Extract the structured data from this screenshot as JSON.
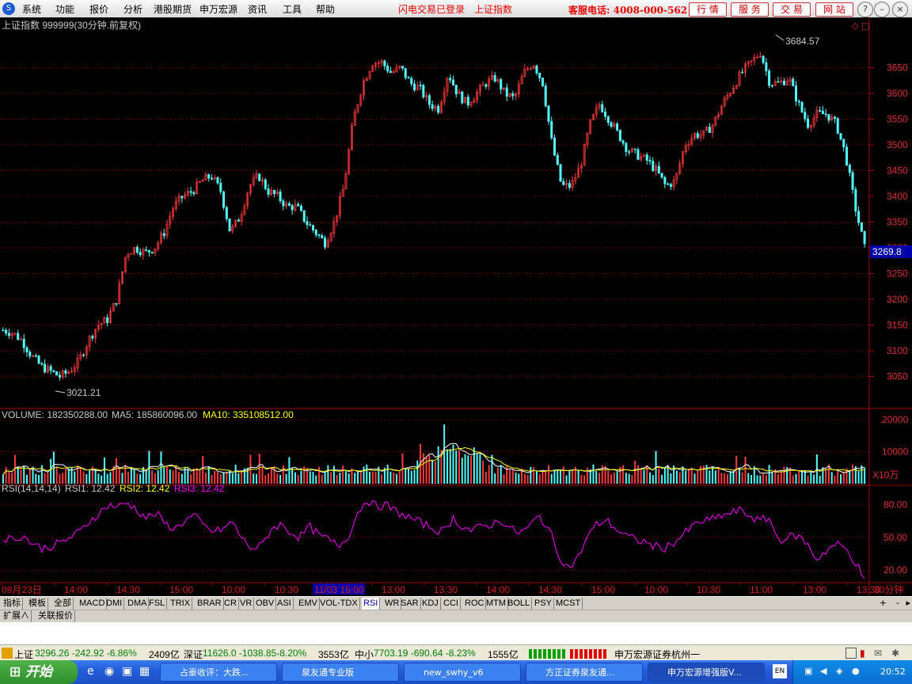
{
  "menubar": {
    "items": [
      "系统",
      "功能",
      "报价",
      "分析",
      "港股期货",
      "申万宏源",
      "资讯",
      "工具",
      "帮助"
    ],
    "notice1": "闪电交易已登录",
    "notice2": "上证指数",
    "hotline": "客服电话: 4008-000-562",
    "buttons": [
      "行 情",
      "服 务",
      "交 易",
      "网 站"
    ]
  },
  "chart": {
    "title": "上证指数 999999(30分钟.前复权)",
    "price_label": "3269.8",
    "high_label": "3684.57",
    "low_label": "3021.21",
    "volume_header": {
      "volume": "VOLUME: 182350288.00",
      "ma5": "MA5: 185860096.00",
      "ma10": "MA10: 335108512.00"
    },
    "volume_unit": "X10万",
    "rsi_header": {
      "name": "RSI(14,14,14)",
      "rsi1": "RSI1: 12.42",
      "rsi2": "RSI2: 12.42",
      "rsi3": "RSI3: 12.42"
    },
    "period_label": "30分钟",
    "time_labels": [
      "09月23日",
      "14:00",
      "14:30",
      "15:00",
      "10:00",
      "10:30",
      "11/03 15:00",
      "13:00",
      "13:30",
      "14:00",
      "14:30",
      "15:00",
      "10:00",
      "10:30",
      "11:00",
      "13:00",
      "13:30"
    ],
    "colors": {
      "up": "#ff3b3b",
      "down": "#54ffff",
      "ma5": "#ffffff",
      "ma10": "#ffff00",
      "rsi": "#ff00ff",
      "grid": "#7a0000"
    }
  },
  "chart_data": [
    {
      "type": "candlestick",
      "title": "上证指数 999999(30分钟.前复权)",
      "ylim": [
        3000,
        3720
      ],
      "yticks": [
        3050,
        3100,
        3150,
        3200,
        3250,
        3300,
        3350,
        3400,
        3450,
        3500,
        3550,
        3600,
        3650
      ],
      "annotations": {
        "high": 3684.57,
        "low": 3021.21,
        "last": 3269.8
      },
      "close_approx": [
        3140,
        3135,
        3120,
        3090,
        3070,
        3060,
        3050,
        3060,
        3080,
        3120,
        3150,
        3160,
        3200,
        3290,
        3300,
        3290,
        3300,
        3330,
        3380,
        3400,
        3410,
        3430,
        3440,
        3410,
        3330,
        3360,
        3420,
        3440,
        3410,
        3400,
        3380,
        3380,
        3350,
        3330,
        3310,
        3350,
        3420,
        3550,
        3620,
        3660,
        3660,
        3640,
        3650,
        3620,
        3610,
        3580,
        3570,
        3640,
        3600,
        3580,
        3600,
        3620,
        3630,
        3600,
        3590,
        3640,
        3660,
        3620,
        3500,
        3420,
        3420,
        3460,
        3540,
        3580,
        3550,
        3520,
        3490,
        3480,
        3470,
        3450,
        3420,
        3430,
        3500,
        3520,
        3520,
        3540,
        3580,
        3610,
        3640,
        3660,
        3680,
        3620,
        3620,
        3630,
        3580,
        3540,
        3560,
        3560,
        3540,
        3480,
        3380,
        3300
      ],
      "xlabels": [
        "09月23日",
        "14:00",
        "14:30",
        "15:00",
        "10:00",
        "10:30",
        "11/03 15:00",
        "13:00",
        "13:30",
        "14:00",
        "14:30",
        "15:00",
        "10:00",
        "10:30",
        "11:00",
        "13:00",
        "13:30"
      ]
    },
    {
      "type": "bar",
      "title": "VOLUME",
      "unit": "X10万",
      "ylim": [
        0,
        22000
      ],
      "yticks": [
        10000,
        20000
      ],
      "value_range_approx": [
        1500,
        19000
      ]
    },
    {
      "type": "line",
      "title": "RSI(14,14,14)",
      "ylim": [
        10,
        95
      ],
      "yticks": [
        20,
        50,
        80
      ],
      "values_approx": [
        50,
        48,
        52,
        45,
        40,
        42,
        45,
        50,
        55,
        65,
        72,
        80,
        78,
        82,
        75,
        68,
        72,
        62,
        58,
        66,
        70,
        60,
        55,
        58,
        64,
        48,
        40,
        42,
        58,
        62,
        55,
        50,
        60,
        52,
        48,
        42,
        50,
        72,
        85,
        78,
        80,
        74,
        70,
        66,
        62,
        58,
        55,
        68,
        60,
        56,
        60,
        62,
        66,
        58,
        54,
        60,
        70,
        58,
        35,
        22,
        30,
        50,
        62,
        66,
        58,
        52,
        48,
        46,
        42,
        40,
        45,
        52,
        60,
        65,
        66,
        70,
        72,
        75,
        70,
        65,
        68,
        48,
        50,
        52,
        44,
        30,
        38,
        44,
        40,
        28,
        12
      ]
    }
  ],
  "tabs": [
    "指标",
    "模板",
    "全部",
    "MACD",
    "DMI",
    "DMA",
    "FSL",
    "TRIX",
    "BRAR",
    "CR",
    "VR",
    "OBV",
    "ASI",
    "EMV",
    "VOL-TDX",
    "RSI",
    "WR",
    "SAR",
    "KDJ",
    "CCI",
    "ROC",
    "MTM",
    "BOLL",
    "PSY",
    "MCST"
  ],
  "subtabs": [
    "扩展∧",
    "关联报价"
  ],
  "statusbar": {
    "sh_label": "上证",
    "sh_value": "3296.26 -242.92 -6.86%",
    "sh_amount": "2409亿",
    "sz_label": "深证",
    "sz_value": "11626.0 -1038.85-8.20%",
    "sz_amount": "3553亿",
    "zx_label": "中小",
    "zx_value": "7703.19 -690.64 -8.23%",
    "zx_amount": "1555亿",
    "broker": "申万宏源证券杭州一"
  },
  "taskbar": {
    "start": "开始",
    "tasks": [
      "占豪收评：大跌...",
      "泉友通专业版",
      "new_swhy_v6",
      "方正证券泉友通...",
      "申万宏源增强版V..."
    ],
    "clock": "20:52"
  }
}
